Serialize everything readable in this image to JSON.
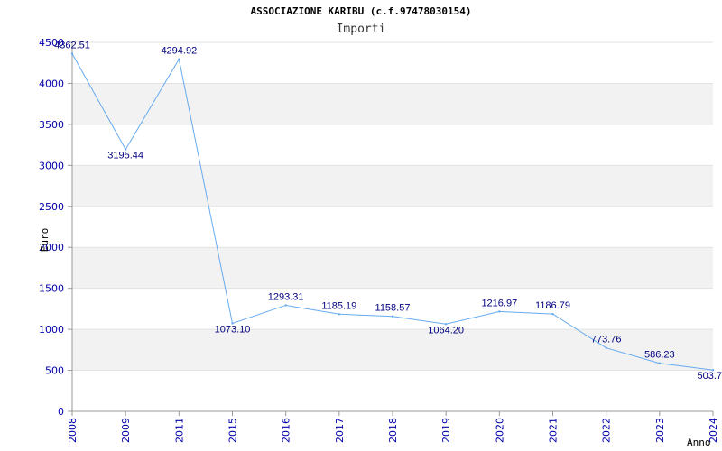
{
  "title": "ASSOCIAZIONE KARIBU (c.f.97478030154)",
  "subtitle": "Importi",
  "chart_data": {
    "type": "line",
    "title": "ASSOCIAZIONE KARIBU (c.f.97478030154)",
    "subtitle": "Importi",
    "xlabel": "Anno",
    "ylabel": "Euro",
    "categories": [
      "2008",
      "2009",
      "2011",
      "2015",
      "2016",
      "2017",
      "2018",
      "2019",
      "2020",
      "2021",
      "2022",
      "2023",
      "2024"
    ],
    "series": [
      {
        "values": [
          4362.51,
          3195.44,
          4294.92,
          1073.1,
          1293.31,
          1185.19,
          1158.57,
          1064.2,
          1216.97,
          1186.79,
          773.76,
          586.23,
          503.7
        ],
        "labels": [
          "4362.51",
          "3195.44",
          "4294.92",
          "1073.10",
          "1293.31",
          "1185.19",
          "1158.57",
          "1064.20",
          "1216.97",
          "1186.79",
          "773.76",
          "586.23",
          "503.7"
        ]
      }
    ],
    "ylim": [
      0,
      4500
    ],
    "yticks": [
      0,
      500,
      1000,
      1500,
      2000,
      2500,
      3000,
      3500,
      4000,
      4500
    ],
    "grid": "horizontal alternating bands",
    "line_color": "#66aaee",
    "band_color": "#f2f2f2",
    "tick_color": "#0000aa",
    "label_color": "#000080"
  }
}
